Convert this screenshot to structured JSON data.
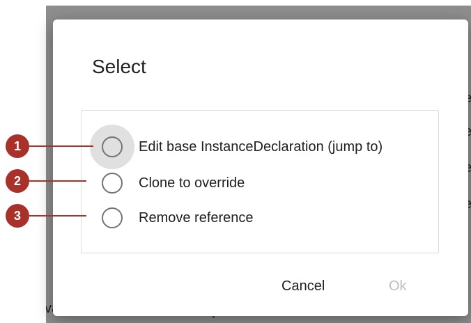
{
  "background": {
    "fragments": [
      "e",
      "e",
      "e",
      "e",
      "va",
      "("
    ]
  },
  "dialog": {
    "title": "Select",
    "options": [
      {
        "label": "Edit base InstanceDeclaration (jump to)",
        "selected": false,
        "focused": true
      },
      {
        "label": "Clone to override",
        "selected": false,
        "focused": false
      },
      {
        "label": "Remove reference",
        "selected": false,
        "focused": false
      }
    ],
    "buttons": {
      "cancel": "Cancel",
      "ok": "Ok",
      "ok_disabled": true
    }
  },
  "callouts": [
    "1",
    "2",
    "3"
  ],
  "colors": {
    "callout": "#a8322a",
    "backdrop": "#8e8e8e",
    "disabled_text": "#bdbdbd"
  }
}
